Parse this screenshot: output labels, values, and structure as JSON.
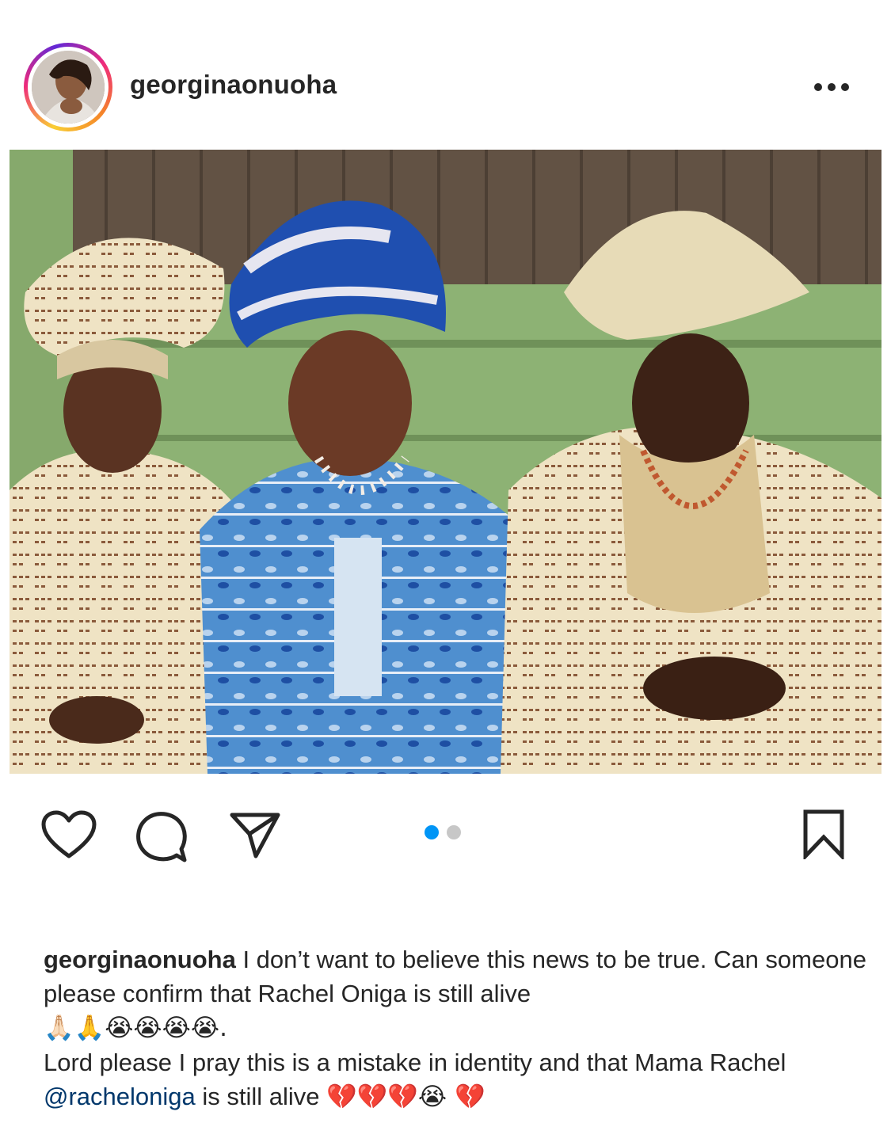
{
  "post": {
    "username": "georginaonuoha",
    "more_icon": "more-horizontal-icon"
  },
  "photo": {
    "alt_subject": "three people in traditional attire"
  },
  "actions": {
    "like_icon": "heart-icon",
    "comment_icon": "comment-icon",
    "share_icon": "paper-plane-icon",
    "save_icon": "bookmark-icon",
    "carousel": {
      "total": 2,
      "active": 1
    }
  },
  "caption": {
    "username": "georginaonuoha",
    "line1": " I don’t want to believe this news to be true. Can someone please confirm that Rachel Oniga is still alive",
    "line1_emojis": "🙏🏻🙏😭😭😭😭.",
    "line2_pre": "Lord please I pray this is a mistake in identity and that Mama Rachel ",
    "mention": "@racheloniga",
    "line2_post": " is still alive ",
    "line2_emojis": "💔💔💔😭 💔"
  },
  "colors": {
    "accent_blue": "#0095f6",
    "mention": "#00376b",
    "text": "#262626"
  }
}
